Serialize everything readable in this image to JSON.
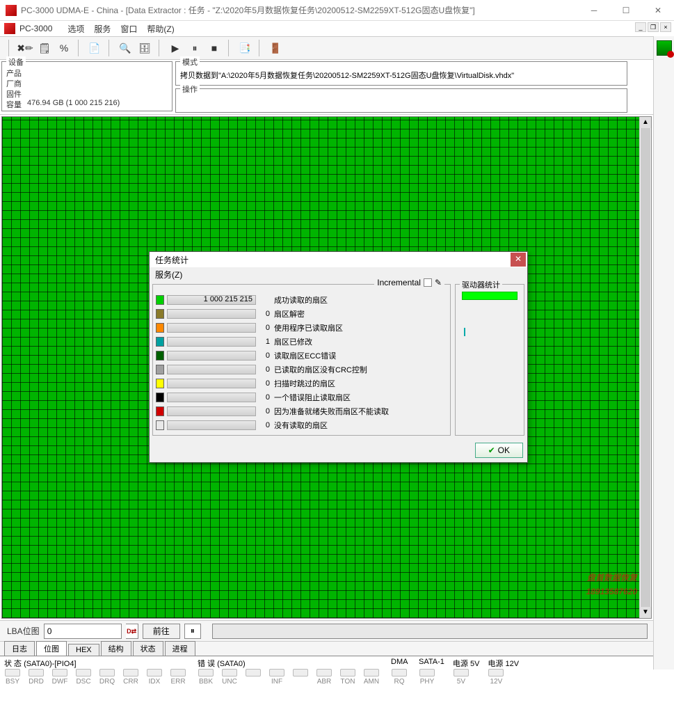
{
  "window": {
    "title": "PC-3000 UDMA-E - China - [Data Extractor : 任务 - \"Z:\\2020年5月数据恢复任务\\20200512-SM2259XT-512G固态U盘恢复\"]"
  },
  "menubar": {
    "app": "PC-3000",
    "items": [
      "选项",
      "服务",
      "窗口",
      "帮助(Z)"
    ]
  },
  "device_panel": {
    "legend": "设备",
    "product_label": "产品",
    "vendor_label": "厂商",
    "firmware_label": "固件",
    "capacity_label": "容量",
    "capacity_value": "476.94 GB (1 000 215 216)"
  },
  "mode_panel": {
    "legend": "模式",
    "value": "拷贝数据到\"A:\\2020年5月数据恢复任务\\20200512-SM2259XT-512G固态U盘恢复\\VirtualDisk.vhdx\""
  },
  "op_panel": {
    "legend": "操作"
  },
  "lba_row": {
    "label": "LBA位图",
    "value": "0",
    "go_button": "前往"
  },
  "tabs": [
    "日志",
    "位图",
    "HEX",
    "结构",
    "状态",
    "进程"
  ],
  "active_tab": 1,
  "dialog": {
    "title": "任务统计",
    "menu": "服务(Z)",
    "incremental_label": "Incremental",
    "drive_legend": "驱动器统计",
    "ok": "OK",
    "rows": [
      {
        "color": "#00d000",
        "value": "1 000 215 215",
        "label": "成功读取的扇区",
        "bar_text": "1 000 215 215"
      },
      {
        "color": "#8a7a2a",
        "value": "0",
        "label": "扇区解密"
      },
      {
        "color": "#ff8800",
        "value": "0",
        "label": "使用程序已读取扇区"
      },
      {
        "color": "#00a0a0",
        "value": "1",
        "label": "扇区已修改"
      },
      {
        "color": "#006000",
        "value": "0",
        "label": "读取扇区ECC错误"
      },
      {
        "color": "#a0a0a0",
        "value": "0",
        "label": "已读取的扇区没有CRC控制"
      },
      {
        "color": "#ffff00",
        "value": "0",
        "label": "扫描时跳过的扇区"
      },
      {
        "color": "#000000",
        "value": "0",
        "label": "一个错误阻止读取扇区"
      },
      {
        "color": "#d00000",
        "value": "0",
        "label": "因为准备就绪失败而扇区不能读取"
      },
      {
        "color": "#e8e8e8",
        "value": "0",
        "label": "没有读取的扇区"
      }
    ]
  },
  "status": {
    "groups": [
      {
        "title": "状 态 (SATA0)-[PIO4]",
        "leds": [
          "BSY",
          "DRD",
          "DWF",
          "DSC",
          "DRQ",
          "CRR",
          "IDX",
          "ERR"
        ]
      },
      {
        "title": "错 误 (SATA0)",
        "leds": [
          "BBK",
          "UNC",
          "",
          "INF",
          "",
          "ABR",
          "TON",
          "AMN"
        ]
      },
      {
        "title": "DMA",
        "leds": [
          "RQ"
        ]
      },
      {
        "title": "SATA-1",
        "leds": [
          "PHY"
        ]
      },
      {
        "title": "电源 5V",
        "leds": [
          "5V"
        ]
      },
      {
        "title": "电源 12V",
        "leds": [
          "12V"
        ]
      }
    ]
  },
  "watermark": {
    "line1": "盘首数据恢复",
    "line2": "18913587620"
  }
}
